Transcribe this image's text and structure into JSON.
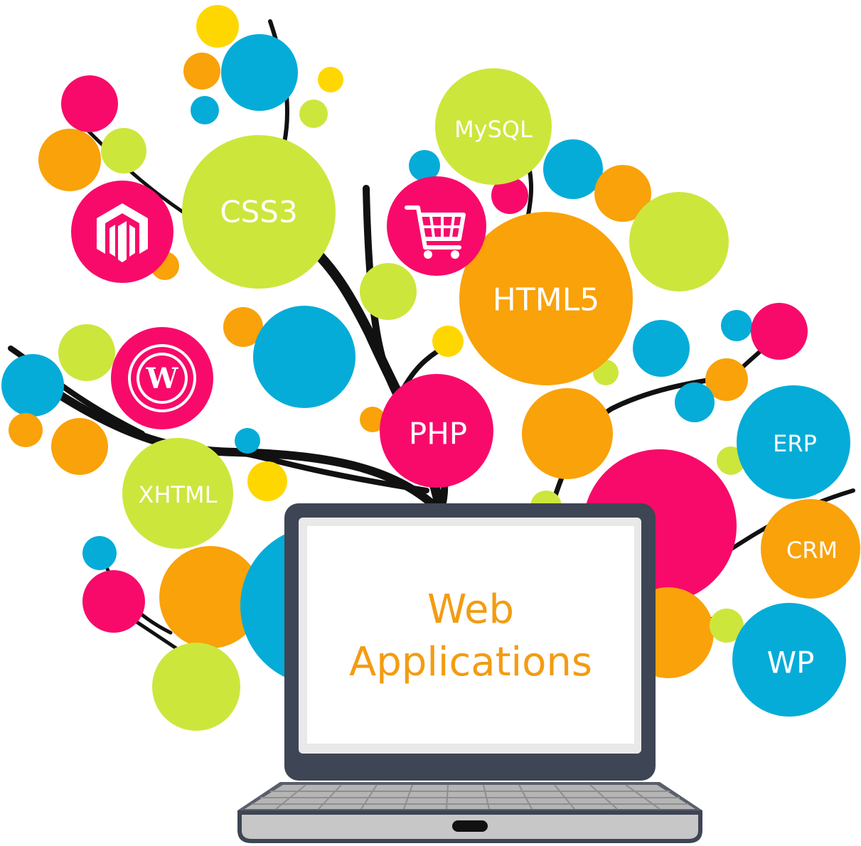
{
  "colors": {
    "green": "#cde63c",
    "blue": "#05acd8",
    "orange": "#f9a20a",
    "pink": "#f80a6a",
    "yellow": "#ffd700",
    "laptop_frame": "#3e4554",
    "screen": "#ffffff",
    "screen_text": "#f39c12",
    "keyboard": "#b5b5b5"
  },
  "bubbles": {
    "mysql": "MySQL",
    "css3": "CSS3",
    "html5": "HTML5",
    "php": "PHP",
    "xhtml": "XHTML",
    "erp": "ERP",
    "crm": "CRM",
    "wp": "WP"
  },
  "icons": {
    "magento": "magento-logo-icon",
    "wordpress": "wordpress-logo-icon",
    "cart": "shopping-cart-icon"
  },
  "laptop": {
    "title_line1": "Web",
    "title_line2": "Applications"
  }
}
